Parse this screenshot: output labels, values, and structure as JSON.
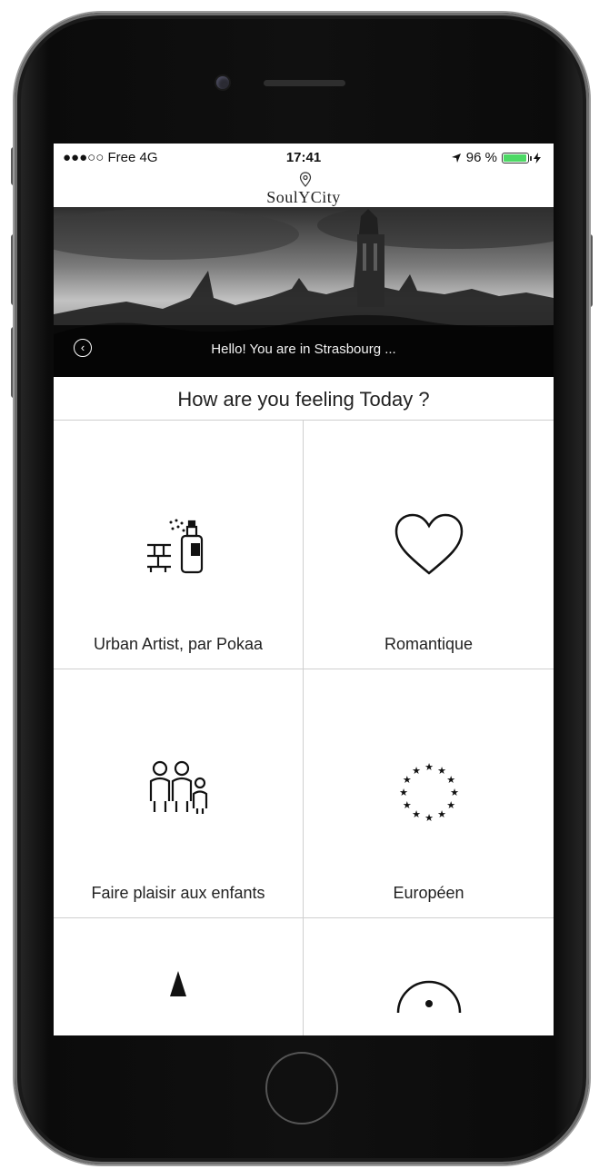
{
  "status_bar": {
    "carrier": "●●●○○ Free  4G",
    "time": "17:41",
    "battery": "96 %",
    "battery_level": 0.96
  },
  "app": {
    "logo": "SoulYCity"
  },
  "banner": {
    "text": "Hello! You are in Strasbourg ..."
  },
  "question": "How are you feeling Today ?",
  "moods": [
    {
      "label": "Urban Artist, par Pokaa",
      "icon": "spray-paint-icon"
    },
    {
      "label": "Romantique",
      "icon": "heart-icon"
    },
    {
      "label": "Faire plaisir aux enfants",
      "icon": "family-icon"
    },
    {
      "label": "Européen",
      "icon": "eu-stars-icon"
    },
    {
      "label": "",
      "icon": "triangle-icon"
    },
    {
      "label": "",
      "icon": "circle-icon"
    }
  ],
  "colors": {
    "battery": "#4cd964",
    "divider": "#cfcfcf"
  }
}
